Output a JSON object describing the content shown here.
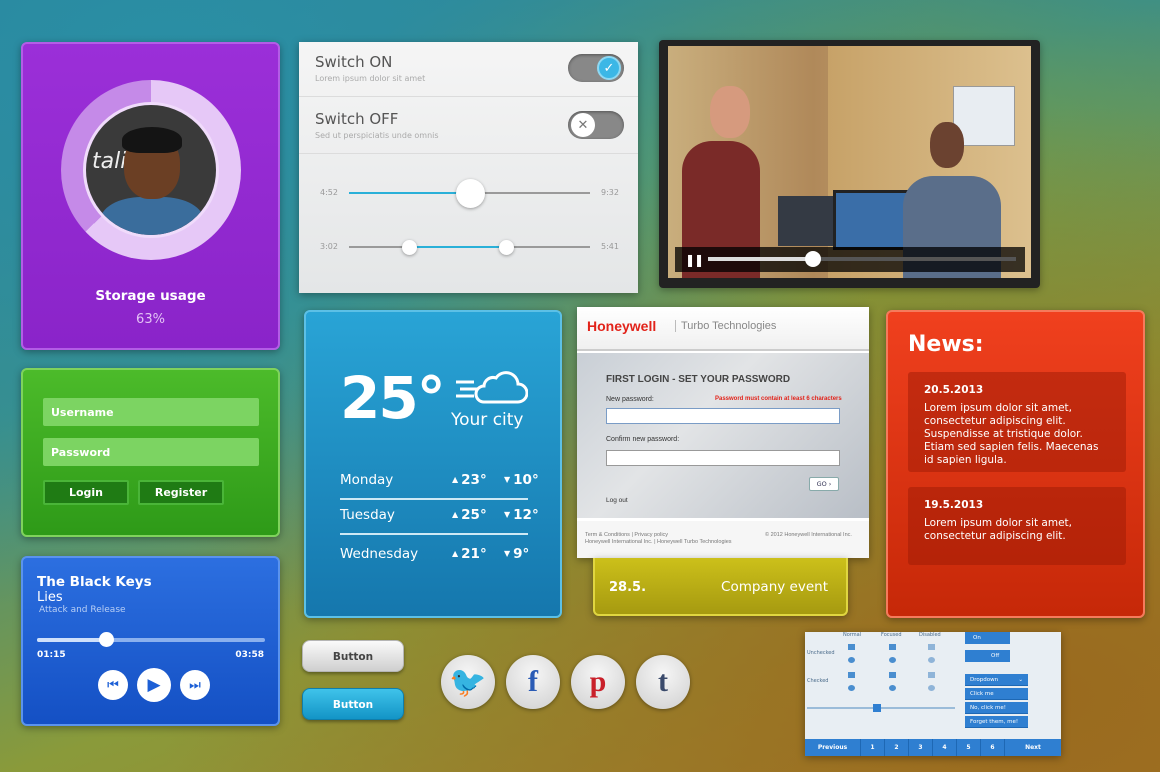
{
  "storage": {
    "label": "Storage usage",
    "percent_text": "63%",
    "percent": 0.63,
    "photo_text": "talio"
  },
  "login": {
    "username_placeholder": "Username",
    "password_placeholder": "Password",
    "login_label": "Login",
    "register_label": "Register"
  },
  "player": {
    "artist": "The Black Keys",
    "track": "Lies",
    "album": "Attack and Release",
    "elapsed": "01:15",
    "total": "03:58",
    "progress": 0.31
  },
  "switches": {
    "on": {
      "title": "Switch ON",
      "subtitle": "Lorem ipsum dolor sit amet",
      "state": true
    },
    "off": {
      "title": "Switch OFF",
      "subtitle": "Sed ut perspiciatis unde omnis",
      "state": false
    },
    "slider1": {
      "min_label": "4:52",
      "max_label": "9:32",
      "value": 0.5
    },
    "slider2": {
      "min_label": "3:02",
      "max_label": "5:41",
      "low": 0.25,
      "high": 0.65
    }
  },
  "video": {
    "progress": 0.34
  },
  "weather": {
    "temp": "25°",
    "city": "Your city",
    "days": [
      {
        "name": "Monday",
        "high": "23°",
        "low": "10°"
      },
      {
        "name": "Tuesday",
        "high": "25°",
        "low": "12°"
      },
      {
        "name": "Wednesday",
        "high": "21°",
        "low": "9°"
      }
    ]
  },
  "honeywell": {
    "brand": "Honeywell",
    "tagline": "Turbo Technologies",
    "title": "FIRST LOGIN - SET YOUR PASSWORD",
    "new_pw_label": "New password:",
    "warning": "Password must contain at least 6 characters",
    "confirm_label": "Confirm new password:",
    "go_label": "GO",
    "logout": "Log out",
    "footer_links": "Term & Conditions  |  Privacy policy",
    "footer_company": "Honeywell International Inc.  |  Honeywell Turbo Technologies",
    "copyright": "© 2012 Honeywell International Inc."
  },
  "event": {
    "date": "28.5.",
    "title": "Company event"
  },
  "news": {
    "heading": "News:",
    "items": [
      {
        "date": "20.5.2013",
        "text": "Lorem ipsum dolor sit amet, consectetur adipiscing elit. Suspendisse at tristique dolor. Etiam sed sapien felis. Maecenas id sapien ligula."
      },
      {
        "date": "19.5.2013",
        "text": "Lorem ipsum dolor sit amet, consectetur adipiscing elit."
      }
    ]
  },
  "buttons": {
    "gray_label": "Button",
    "blue_label": "Button"
  },
  "social": [
    {
      "name": "twitter-icon",
      "glyph": "🐦",
      "color": "#1d9bd8"
    },
    {
      "name": "facebook-icon",
      "glyph": "f",
      "color": "#2a5bb5"
    },
    {
      "name": "pinterest-icon",
      "glyph": "p",
      "color": "#c9202a"
    },
    {
      "name": "tumblr-icon",
      "glyph": "t",
      "color": "#3a4a6b"
    }
  ],
  "kit": {
    "col_normal": "Normal",
    "col_focused": "Focused",
    "col_disabled": "Disabled",
    "row_unchecked": "Unchecked",
    "row_checked": "Checked",
    "on": "On",
    "off": "Off",
    "dropdown": "Dropdown",
    "options": [
      "Click me",
      "No, click me!",
      "Forget them, me!"
    ],
    "pagination": [
      "Previous",
      "1",
      "2",
      "3",
      "4",
      "5",
      "6",
      "Next"
    ]
  },
  "colors": {
    "storage": "#9b2fd8",
    "login": "#3fae22",
    "player": "#1f5fd6",
    "weather": "#1f8ec4",
    "news": "#e23512",
    "event": "#bcae15",
    "accent": "#2ab0d8"
  }
}
